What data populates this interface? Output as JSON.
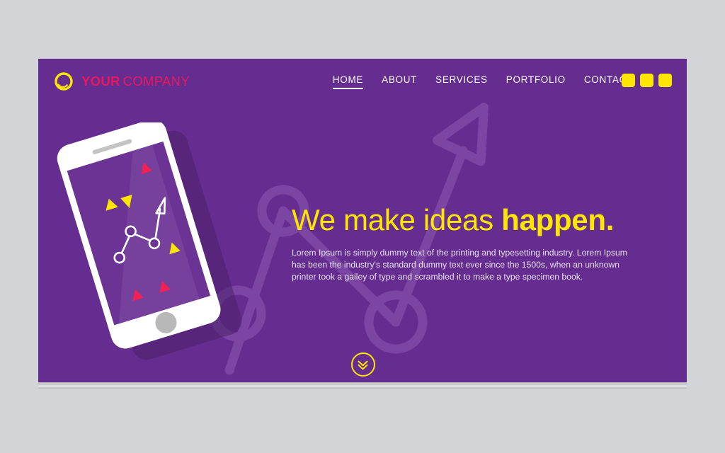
{
  "page": {
    "background_color": "#d2d4d7",
    "hero_background_color": "#662d91"
  },
  "header": {
    "logo": {
      "icon": "ring-crescent-logo-icon",
      "text_bold": "YOUR",
      "text_light": "COMPANY",
      "color": "#e8185d",
      "mark_color": "#ffe600"
    },
    "nav": [
      {
        "label": "HOME",
        "active": true
      },
      {
        "label": "ABOUT",
        "active": false
      },
      {
        "label": "SERVICES",
        "active": false
      },
      {
        "label": "PORTFOLIO",
        "active": false
      },
      {
        "label": "CONTACT",
        "active": false
      }
    ],
    "action_squares": [
      {
        "name": "header-square-1",
        "color": "#ffe600"
      },
      {
        "name": "header-square-2",
        "color": "#ffe600"
      },
      {
        "name": "header-square-3",
        "color": "#ffe600"
      }
    ]
  },
  "hero": {
    "headline_light": "We make ideas",
    "headline_bold": "happen.",
    "headline_color": "#ffe600",
    "body": "Lorem Ipsum is simply dummy text of the printing and typesetting industry. Lorem Ipsum has been the industry's standard dummy text ever since the 1500s, when an unknown printer took a galley of type and scrambled it to make a type specimen book.",
    "body_color": "#e7dff0",
    "scroll_indicator": "double-chevron-down-icon"
  },
  "illustration": {
    "name": "tilted-smartphone-with-growth-chart",
    "phone_body_color": "#ffffff",
    "phone_screen_color": "#6b3494",
    "home_button_color": "#b8b8b8",
    "speaker_color": "#c4c4c4",
    "chart_line_color": "#ffffff",
    "markers": [
      {
        "shape": "triangle-up",
        "color": "#ffe600"
      },
      {
        "shape": "triangle-down",
        "color": "#ffe600"
      },
      {
        "shape": "triangle-up",
        "color": "#ffe600"
      },
      {
        "shape": "triangle-down",
        "color": "#f32053"
      },
      {
        "shape": "triangle-up",
        "color": "#f32053"
      },
      {
        "shape": "triangle-up",
        "color": "#f32053"
      }
    ]
  },
  "background_motif": {
    "name": "oversized-growth-chart-outline",
    "color": "#7b45a3",
    "elements": [
      "arrow-head-outline",
      "circle-node-outline",
      "circle-node-outline",
      "circle-node-outline",
      "connector-lines"
    ]
  }
}
